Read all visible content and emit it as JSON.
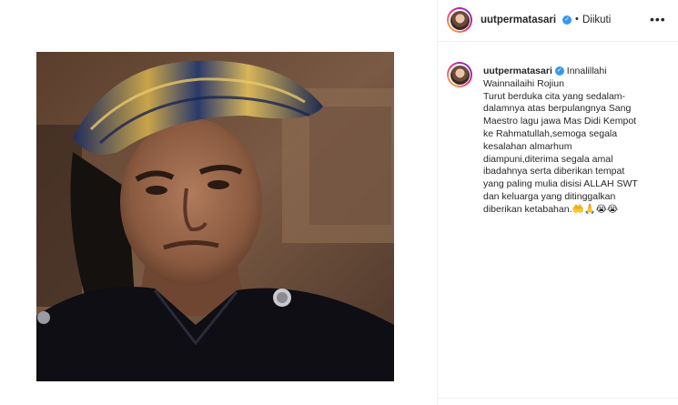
{
  "post": {
    "username": "uutpermatasari",
    "follow_dot": "•",
    "follow_status": "Diikuti",
    "more_icon": "•••",
    "verified_icon": "✓"
  },
  "caption": {
    "username": "uutpermatasari",
    "first_line": "Innalillahi",
    "lines": [
      "Wainnailaihi Rojiun",
      "Turut berduka cita yang sedalam-",
      "dalamnya atas berpulangnya Sang",
      "Maestro lagu jawa Mas Didi Kempot",
      "ke Rahmatullah,semoga segala",
      "kesalahan almarhum",
      "diampuni,diterima segala amal",
      "ibadahnya serta diberikan tempat",
      "yang paling mulia disisi ALLAH SWT",
      "dan keluarga yang ditinggalkan",
      "diberikan ketabahan.🤲🙏😭😭"
    ]
  },
  "colors": {
    "text": "#262626",
    "verified": "#3897f0",
    "divider": "#efefef"
  }
}
